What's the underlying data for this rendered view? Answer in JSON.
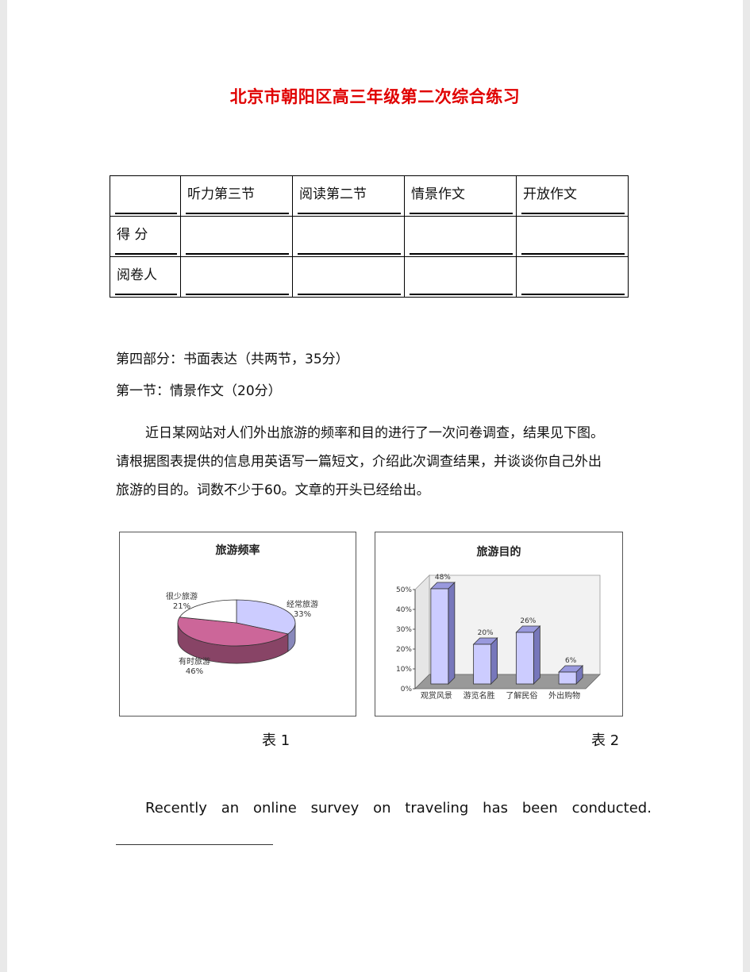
{
  "document": {
    "title": "北京市朝阳区高三年级第二次综合练习"
  },
  "score_table": {
    "headers": [
      "",
      "听力第三节",
      "阅读第二节",
      "情景作文",
      "开放作文"
    ],
    "rows": [
      {
        "label": "得  分",
        "cells": [
          "",
          "",
          "",
          ""
        ]
      },
      {
        "label": "阅卷人",
        "cells": [
          "",
          "",
          "",
          ""
        ]
      }
    ]
  },
  "section": {
    "part_heading": "第四部分：书面表达（共两节，35分）",
    "sub_heading": "第一节：情景作文（20分）",
    "instructions": [
      "近日某网站对人们外出旅游的频率和目的进行了一次问卷调查，结果见下图。",
      "请根据图表提供的信息用英语写一篇短文，介绍此次调查结果，并谈谈你自己外出",
      "旅游的目的。词数不少于60。文章的开头已经给出。"
    ]
  },
  "chart_data": [
    {
      "type": "pie",
      "title": "旅游频率",
      "labels": [
        "经常旅游",
        "有时旅游",
        "很少旅游"
      ],
      "values": [
        33,
        46,
        21
      ],
      "unit": "%",
      "colors": [
        "#ccccff",
        "#cc6699",
        "#ffffff"
      ],
      "caption": "表 1"
    },
    {
      "type": "bar",
      "title": "旅游目的",
      "categories": [
        "观赏风景",
        "游览名胜",
        "了解民俗",
        "外出购物"
      ],
      "values": [
        48,
        20,
        26,
        6
      ],
      "value_labels": [
        "48%",
        "20%",
        "26%",
        "6%"
      ],
      "yticks": [
        "0%",
        "10%",
        "20%",
        "30%",
        "40%",
        "50%"
      ],
      "ylim": [
        0,
        50
      ],
      "xlabel": "",
      "ylabel": "",
      "grid": false,
      "bar_color": "#ccccff",
      "caption": "表 2"
    }
  ],
  "essay": {
    "opening_words": [
      "Recently",
      "an",
      "online",
      "survey",
      "on",
      "traveling",
      "has",
      "been",
      "conducted."
    ]
  }
}
